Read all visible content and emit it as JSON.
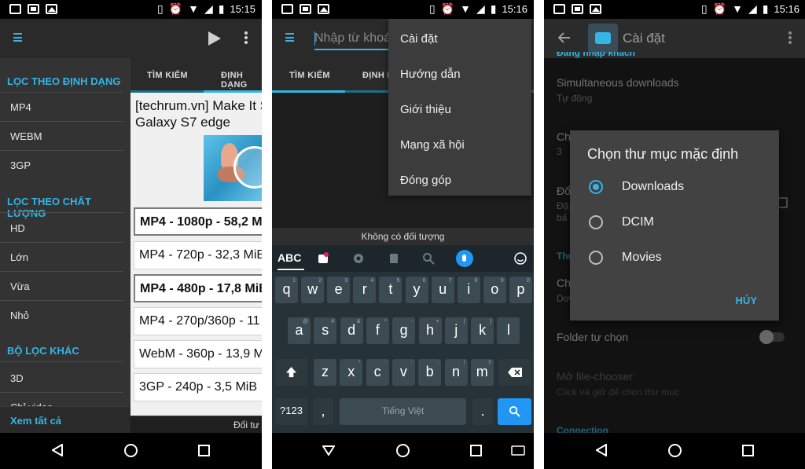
{
  "status_bar": {
    "time_1": "15:15",
    "time_2": "15:16",
    "time_3": "15:16"
  },
  "panel1": {
    "drawer": {
      "section_format": "LỌC THEO ĐỊNH DẠNG",
      "format_items": [
        "MP4",
        "WEBM",
        "3GP"
      ],
      "section_quality": "LỌC THEO CHẤT LƯỢNG",
      "quality_items": [
        "HD",
        "Lớn",
        "Vừa",
        "Nhỏ"
      ],
      "section_other": "BỘ LỌC KHÁC",
      "other_items": [
        "3D",
        "Chỉ video"
      ],
      "footer": "Xem tất cả"
    },
    "tabs": [
      "TÌM KIẾM",
      "ĐỊNH DẠNG"
    ],
    "video_title_line1": "[techrum.vn] Make It S",
    "video_title_line2": "Galaxy S7 edge",
    "formats": [
      "MP4 - 1080p - 58,2 M",
      "MP4 - 720p - 32,3 MiB",
      "MP4 - 480p - 17,8 MiB",
      "MP4 - 270p/360p - 11",
      "WebM - 360p - 13,9 M",
      "3GP - 240p - 3,5 MiB"
    ],
    "bottom_text": "Đối tư"
  },
  "panel2": {
    "search_placeholder": "Nhập từ khoá",
    "tabs": [
      "TÌM KIẾM",
      "ĐỊNH D"
    ],
    "menu": [
      "Cài đặt",
      "Hướng dẫn",
      "Giới thiệu",
      "Mạng xã hội",
      "Đóng góp"
    ],
    "empty_text": "Không có đối tượng",
    "keyboard": {
      "mode": "ABC",
      "row1": [
        "q",
        "w",
        "e",
        "r",
        "t",
        "y",
        "u",
        "i",
        "o",
        "p"
      ],
      "row1_alt": [
        "1",
        "2",
        "3",
        "4",
        "5",
        "6",
        "7",
        "8",
        "9",
        "0"
      ],
      "row2": [
        "a",
        "s",
        "d",
        "f",
        "g",
        "h",
        "j",
        "k",
        "l"
      ],
      "row2_alt": [
        "@",
        "#",
        "&",
        "*",
        "-",
        "+",
        "(",
        ")",
        ""
      ],
      "row3": [
        "z",
        "x",
        "c",
        "v",
        "b",
        "n",
        "m"
      ],
      "row3_alt": [
        "",
        "\"",
        "'",
        ":",
        ";",
        "!",
        "?"
      ],
      "symbols": "?123",
      "comma": ",",
      "space": "Tiếng Việt",
      "period": "."
    }
  },
  "panel3": {
    "title": "Cài đặt",
    "bg_section_top": "Đăng nhập khách",
    "simultaneous": "Simultaneous downloads",
    "simultaneous_value": "Tự động",
    "ch_label": "Ch",
    "ch_value": "3",
    "do_label": "Đổ",
    "da_label": "Đặ",
    "ban_label": "bấ",
    "thu_section": "Thư",
    "ch2_label": "Ch",
    "dow_label": "Dov",
    "folder_label": "Folder tự chọn",
    "filechooser": "Mở file-chooser",
    "filechooser_sub": "Click và giữ để chọn thư mục",
    "connection": "Connection",
    "dialog": {
      "title": "Chọn thư mục mặc định",
      "options": [
        "Downloads",
        "DCIM",
        "Movies"
      ],
      "selected": "Downloads",
      "cancel": "HỦY"
    }
  },
  "colors": {
    "accent": "#33b5e5",
    "dark": "#212121",
    "drawer": "#333333"
  }
}
